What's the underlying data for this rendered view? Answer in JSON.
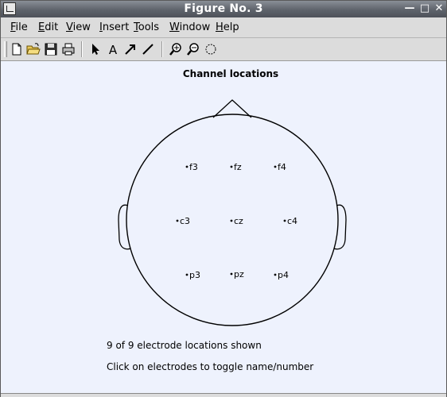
{
  "window": {
    "title": "Figure No. 3",
    "minimize_glyph": "—",
    "maximize_glyph": "□",
    "close_glyph": "✕"
  },
  "menubar": {
    "items": [
      "File",
      "Edit",
      "View",
      "Insert",
      "Tools",
      "Window",
      "Help"
    ]
  },
  "toolbar": {
    "buttons": [
      "new-file-icon",
      "open-folder-icon",
      "save-icon",
      "print-icon",
      "select-arrow-icon",
      "insert-text-icon",
      "insert-arrow-icon",
      "insert-line-icon",
      "zoom-in-icon",
      "zoom-out-icon",
      "rotate-icon"
    ],
    "text_button_glyph": "A"
  },
  "plot": {
    "title": "Channel locations",
    "electrodes": [
      {
        "label": "f3"
      },
      {
        "label": "fz"
      },
      {
        "label": "f4"
      },
      {
        "label": "c3"
      },
      {
        "label": "cz"
      },
      {
        "label": "c4"
      },
      {
        "label": "p3"
      },
      {
        "label": "pz"
      },
      {
        "label": "p4"
      }
    ],
    "shown_text": "9 of 9 electrode locations shown",
    "hint_text": "Click on electrodes to toggle name/number"
  },
  "colors": {
    "canvas_bg": "#eef2fd",
    "titlebar": "#5e636b",
    "head_outline": "#000000"
  }
}
